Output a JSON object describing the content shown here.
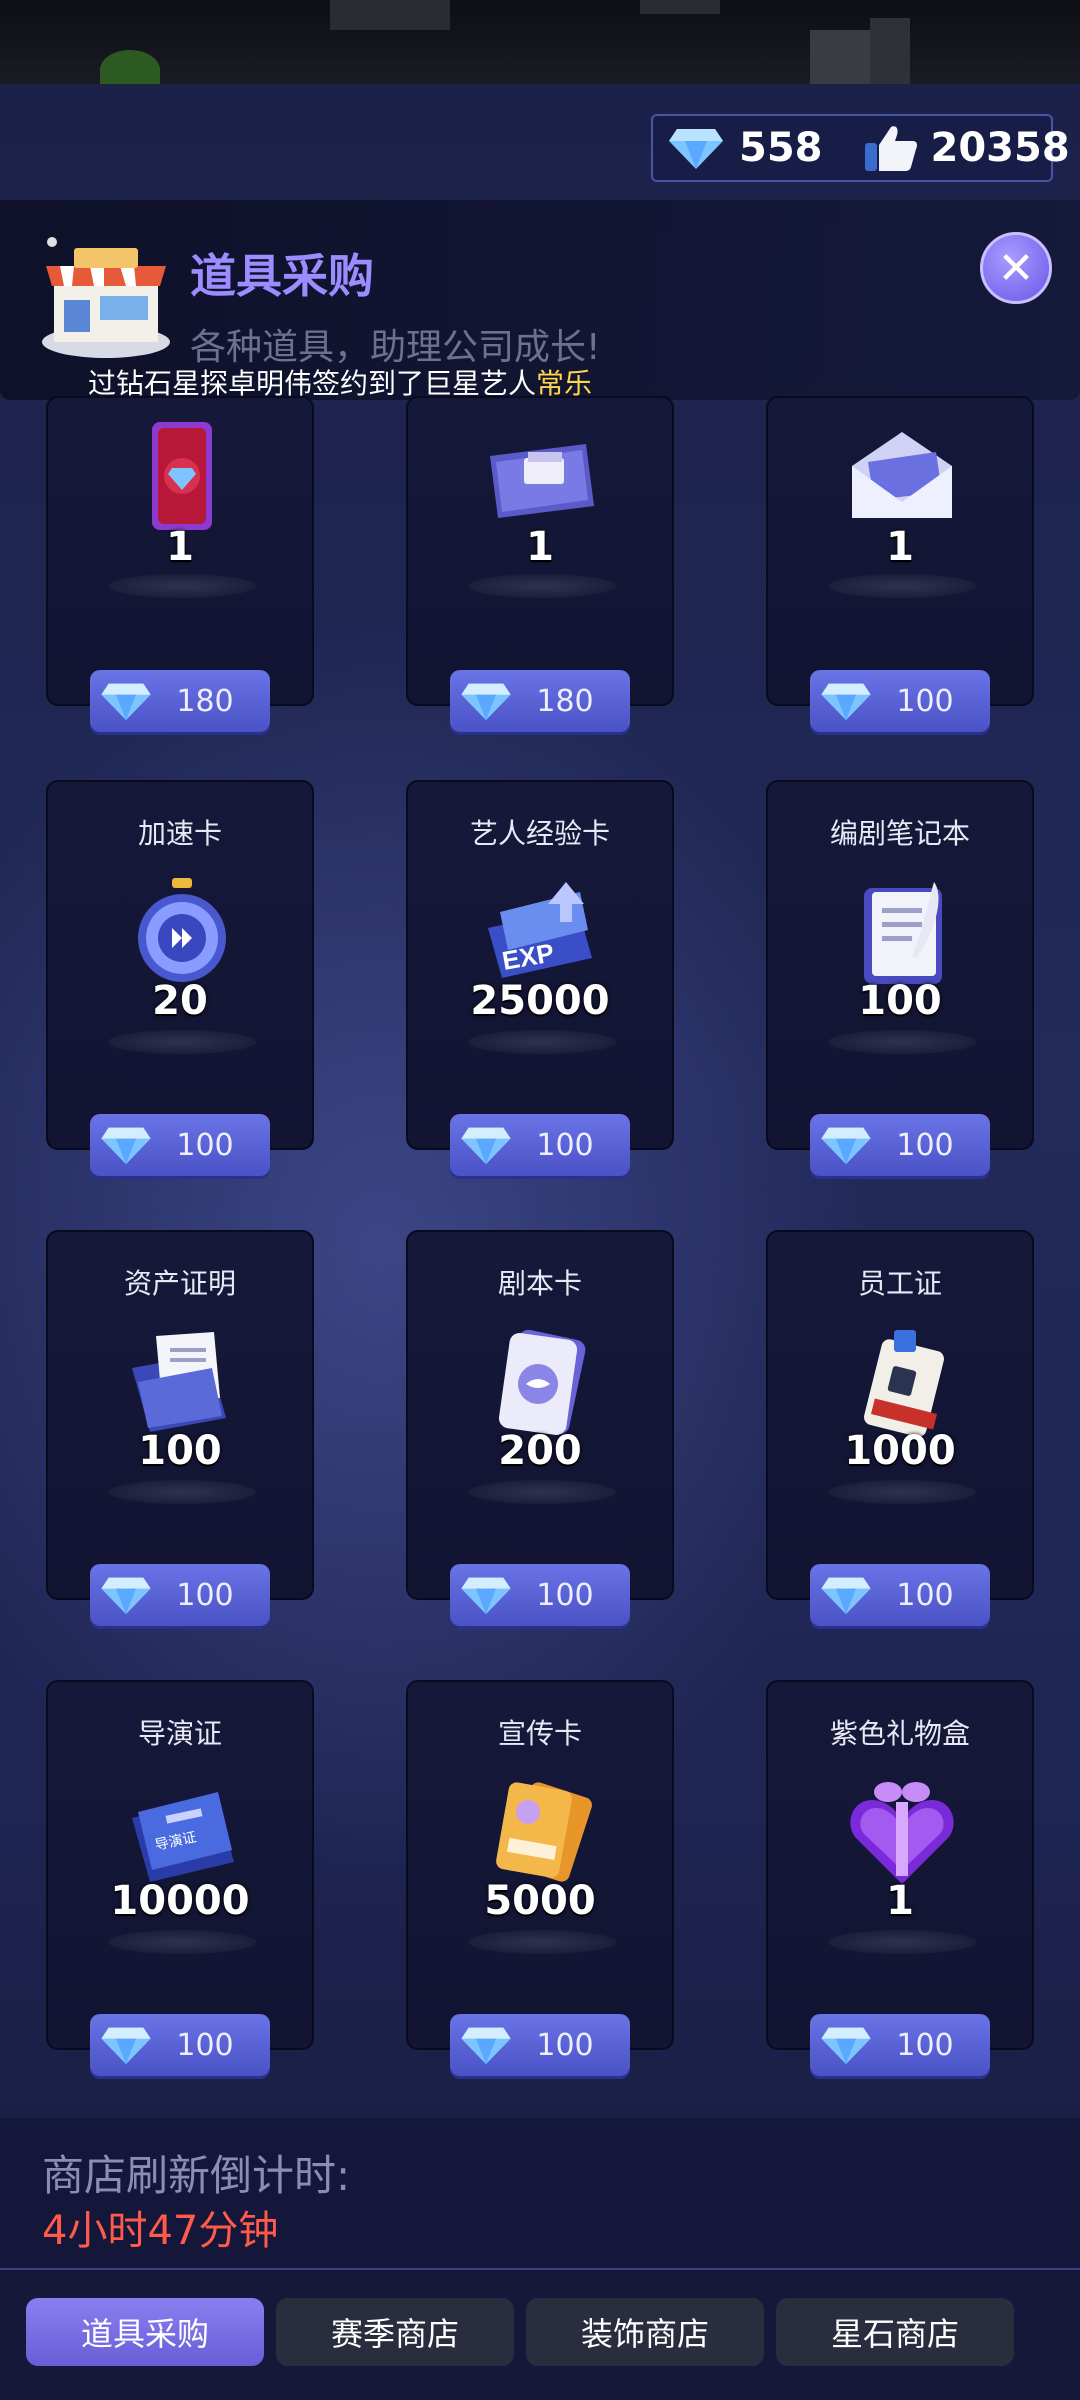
{
  "currency": {
    "diamonds": "558",
    "likes": "20358"
  },
  "header": {
    "title": "道具采购",
    "subtitle": "各种道具，助理公司成长!",
    "ticker_prefix": "过钻石星探卓明伟签约到了巨星艺人",
    "ticker_highlight": "常乐",
    "close_label": "✕"
  },
  "items": [
    {
      "name": "",
      "qty": "1",
      "price": "180",
      "icon": "red-diamond-card-icon"
    },
    {
      "name": "",
      "qty": "1",
      "price": "180",
      "icon": "ticket-icon"
    },
    {
      "name": "",
      "qty": "1",
      "price": "100",
      "icon": "envelope-icon"
    },
    {
      "name": "加速卡",
      "qty": "20",
      "price": "100",
      "icon": "stopwatch-icon"
    },
    {
      "name": "艺人经验卡",
      "qty": "25000",
      "price": "100",
      "icon": "exp-ticket-icon"
    },
    {
      "name": "编剧笔记本",
      "qty": "100",
      "price": "100",
      "icon": "notebook-icon"
    },
    {
      "name": "资产证明",
      "qty": "100",
      "price": "100",
      "icon": "documents-icon"
    },
    {
      "name": "剧本卡",
      "qty": "200",
      "price": "100",
      "icon": "script-card-icon"
    },
    {
      "name": "员工证",
      "qty": "1000",
      "price": "100",
      "icon": "employee-badge-icon"
    },
    {
      "name": "导演证",
      "qty": "10000",
      "price": "100",
      "icon": "director-book-icon"
    },
    {
      "name": "宣传卡",
      "qty": "5000",
      "price": "100",
      "icon": "promo-card-icon"
    },
    {
      "name": "紫色礼物盒",
      "qty": "1",
      "price": "100",
      "icon": "heart-gift-box-icon"
    }
  ],
  "refresh": {
    "label": "商店刷新倒计时:",
    "time": "4小时47分钟"
  },
  "tabs": [
    {
      "label": "道具采购",
      "active": true
    },
    {
      "label": "赛季商店",
      "active": false
    },
    {
      "label": "装饰商店",
      "active": false
    },
    {
      "label": "星石商店",
      "active": false
    }
  ],
  "colors": {
    "accent": "#6a5ed8",
    "title": "#9c8cff",
    "countdown": "#ff5a4a",
    "ticker_highlight": "#ffd54a",
    "price_button": "#5a62d6"
  }
}
